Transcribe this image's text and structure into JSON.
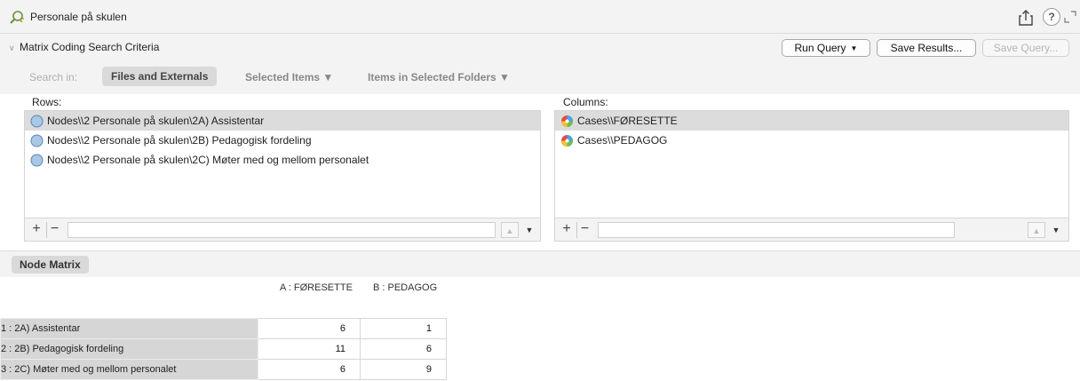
{
  "window": {
    "title": "Personale på skulen",
    "help_label": "?"
  },
  "criteria": {
    "title": "Matrix Coding Search Criteria",
    "run_query": "Run Query",
    "save_results": "Save Results...",
    "save_query": "Save Query..."
  },
  "search": {
    "label": "Search in:",
    "scope_active": "Files and Externals",
    "scope_selected": "Selected Items ▼",
    "scope_folders": "Items in Selected Folders ▼"
  },
  "rows": {
    "label": "Rows:",
    "items": [
      "Nodes\\\\2 Personale på skulen\\2A) Assistentar",
      "Nodes\\\\2 Personale på skulen\\2B) Pedagogisk fordeling",
      "Nodes\\\\2 Personale på skulen\\2C) Møter med og mellom personalet"
    ]
  },
  "columns": {
    "label": "Columns:",
    "items": [
      "Cases\\\\FØRESETTE",
      "Cases\\\\PEDAGOG"
    ]
  },
  "toolbar": {
    "plus": "+",
    "minus": "−",
    "up": "▲",
    "down": "▼"
  },
  "result": {
    "tab_label": "Node Matrix",
    "col_a": "A : FØRESETTE",
    "col_b": "B : PEDAGOG",
    "rows": [
      {
        "label": "1 : 2A) Assistentar",
        "a": "6",
        "b": "1"
      },
      {
        "label": "2 : 2B) Pedagogisk fordeling",
        "a": "11",
        "b": "6"
      },
      {
        "label": "3 : 2C) Møter med og mellom personalet",
        "a": "6",
        "b": "9"
      }
    ]
  },
  "colors": {
    "chrome": "#f3f3f3",
    "selected": "#dcdcdc",
    "pill": "#d9d9d9"
  }
}
